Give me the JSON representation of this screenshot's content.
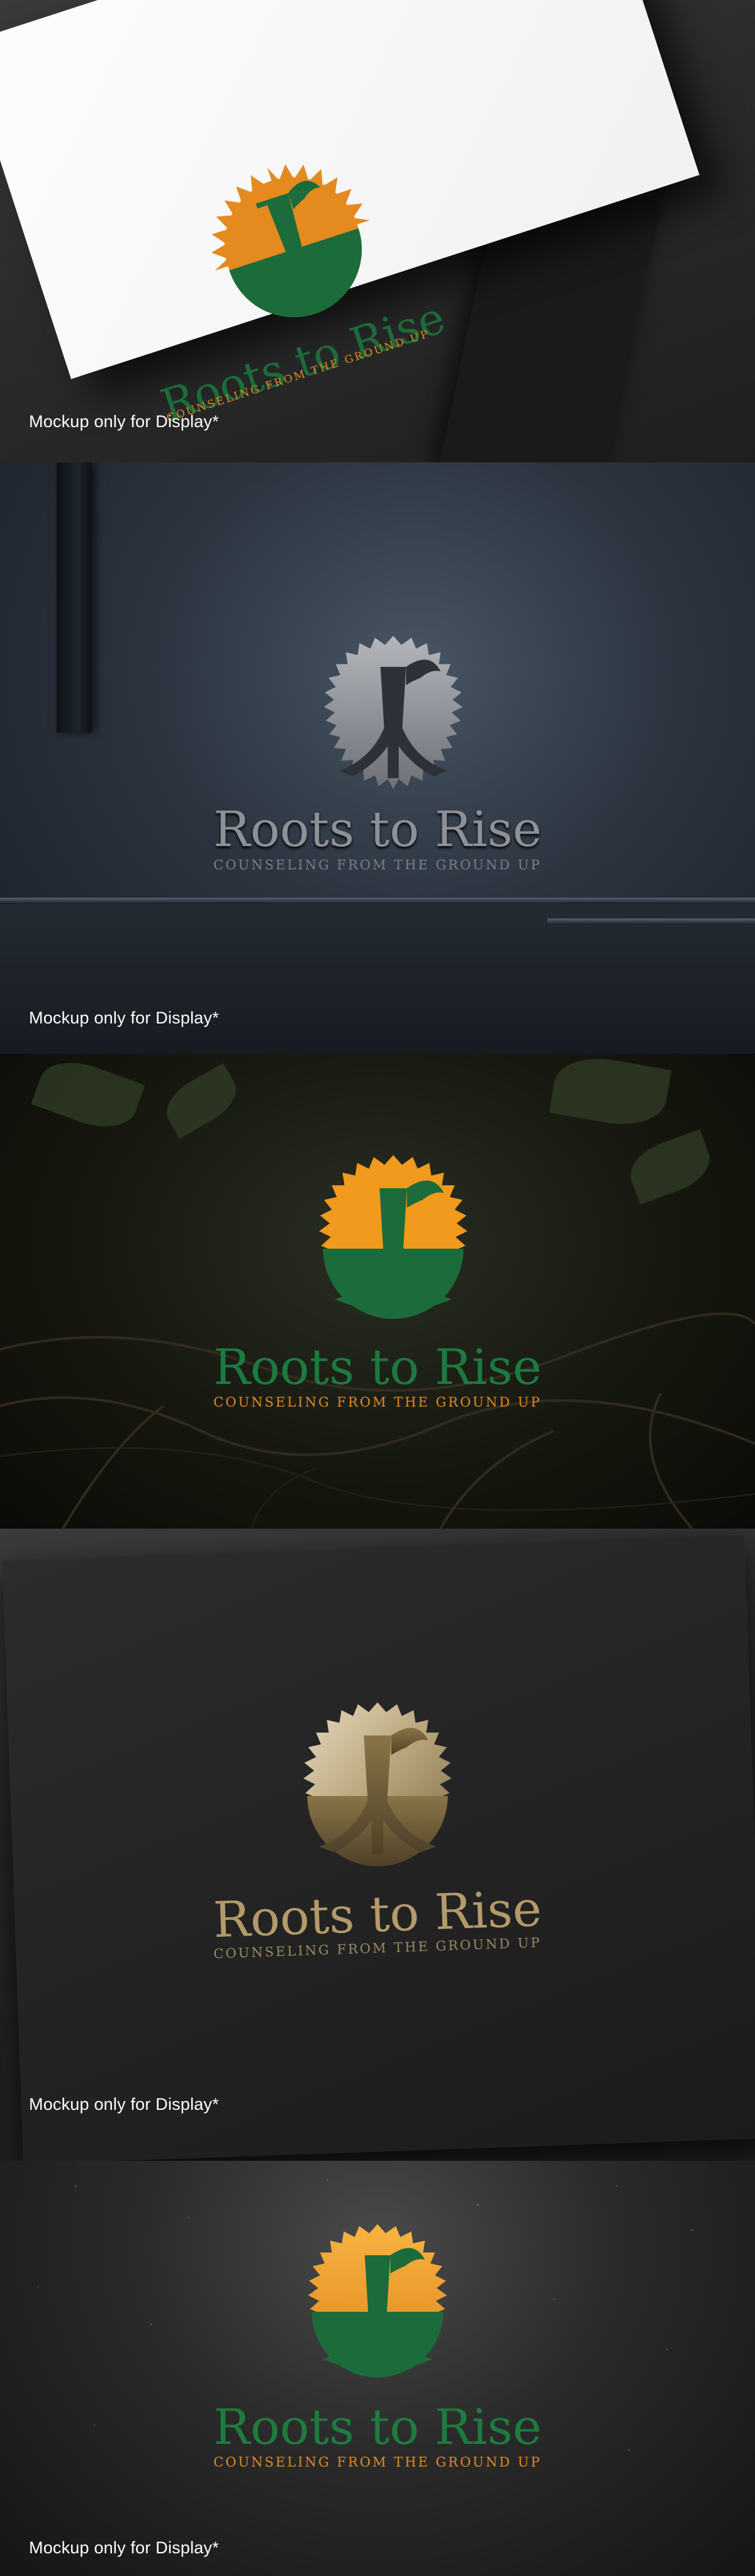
{
  "brand": {
    "name": "Roots to Rise",
    "tagline": "COUNSELING FROM THE GROUND UP",
    "monogram": "r",
    "colors": {
      "orange": "#e48a1f",
      "green": "#1c6b3a",
      "steel": "#8d9096",
      "gold": "#b39a6a"
    }
  },
  "mockups": [
    {
      "caption": "Mockup only for Display*",
      "style": "business-card"
    },
    {
      "caption": "Mockup only for Display*",
      "style": "steel"
    },
    {
      "caption": "",
      "style": "roots-night"
    },
    {
      "caption": "Mockup only for Display*",
      "style": "black-paper-gold"
    },
    {
      "caption": "Mockup only for Display*",
      "style": "sparkle-dark"
    }
  ],
  "icons": {
    "logo": "sun-tree-roots-icon"
  }
}
